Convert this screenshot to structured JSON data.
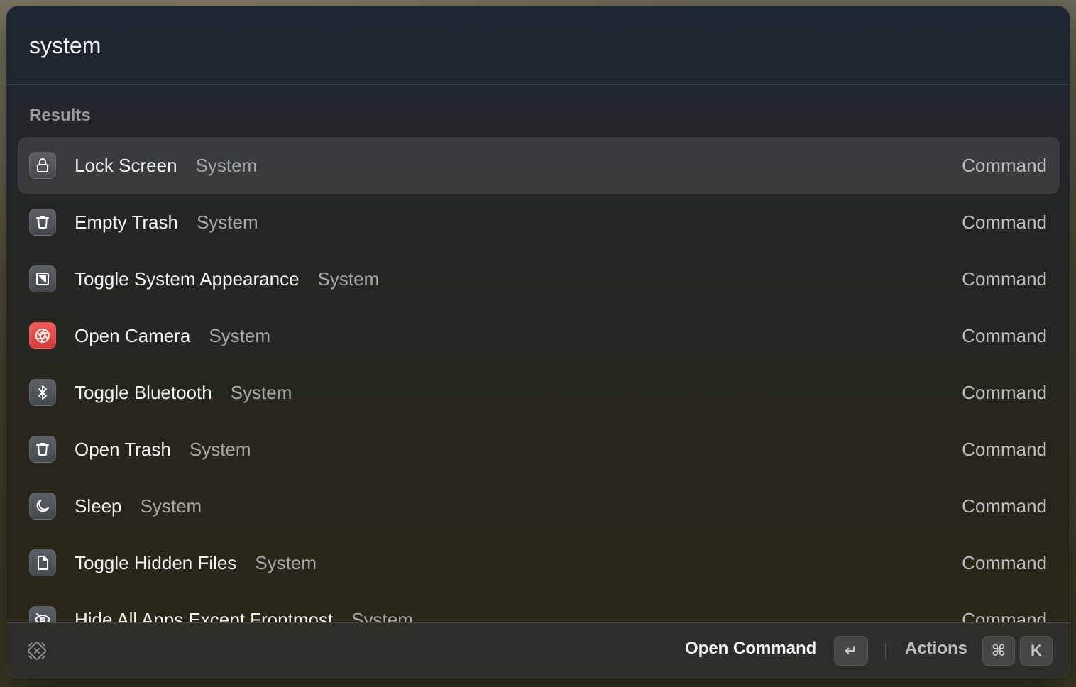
{
  "search": {
    "value": "system"
  },
  "section_title": "Results",
  "results": [
    {
      "title": "Lock Screen",
      "subtitle": "System",
      "accessory": "Command",
      "icon": "lock-icon"
    },
    {
      "title": "Empty Trash",
      "subtitle": "System",
      "accessory": "Command",
      "icon": "trash-icon"
    },
    {
      "title": "Toggle System Appearance",
      "subtitle": "System",
      "accessory": "Command",
      "icon": "appearance-icon"
    },
    {
      "title": "Open Camera",
      "subtitle": "System",
      "accessory": "Command",
      "icon": "camera-aperture-icon"
    },
    {
      "title": "Toggle Bluetooth",
      "subtitle": "System",
      "accessory": "Command",
      "icon": "bluetooth-icon"
    },
    {
      "title": "Open Trash",
      "subtitle": "System",
      "accessory": "Command",
      "icon": "trash-icon"
    },
    {
      "title": "Sleep",
      "subtitle": "System",
      "accessory": "Command",
      "icon": "moon-icon"
    },
    {
      "title": "Toggle Hidden Files",
      "subtitle": "System",
      "accessory": "Command",
      "icon": "document-icon"
    },
    {
      "title": "Hide All Apps Except Frontmost",
      "subtitle": "System",
      "accessory": "Command",
      "icon": "eye-off-icon"
    }
  ],
  "footer": {
    "primary_action": "Open Command",
    "enter_key": "↵",
    "actions_label": "Actions",
    "cmd_key": "⌘",
    "k_key": "K"
  },
  "colors": {
    "camera_icon": "#e84a4a",
    "selected_row": "rgba(255,255,255,0.10)"
  }
}
